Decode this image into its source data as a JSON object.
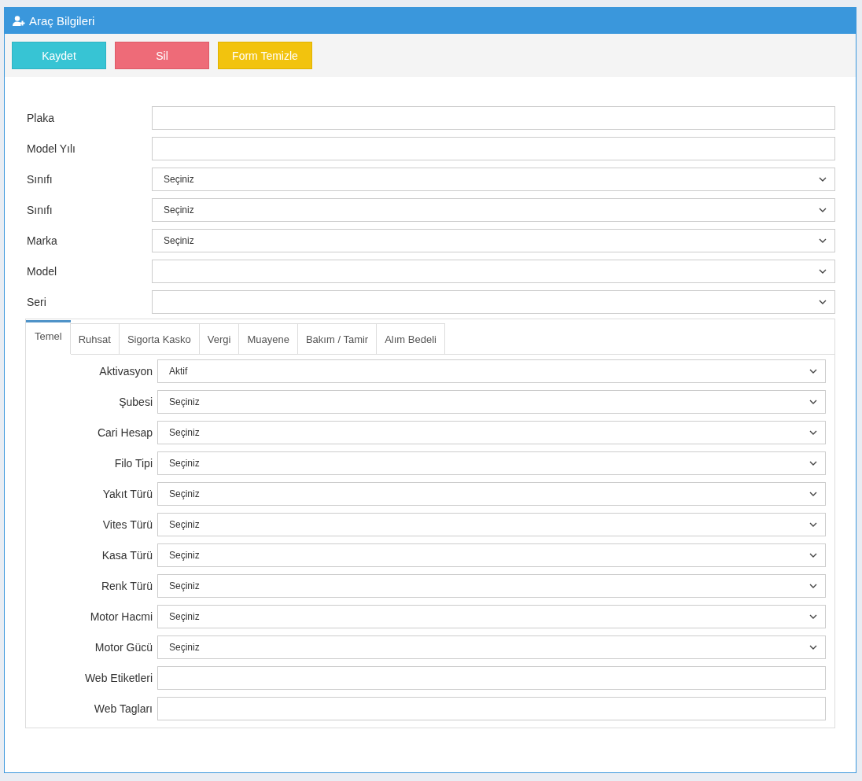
{
  "panel": {
    "title": "Araç Bilgileri"
  },
  "buttons": [
    {
      "label": "Kaydet",
      "kind": "info"
    },
    {
      "label": "Sil",
      "kind": "danger"
    },
    {
      "label": "Form Temizle",
      "kind": "warning"
    }
  ],
  "fields": [
    {
      "label": "Plaka",
      "kind": "text"
    },
    {
      "label": "Model Yılı",
      "kind": "text"
    },
    {
      "label": "Sınıfı",
      "kind": "select",
      "value": "Seçiniz"
    },
    {
      "label": "Sınıfı",
      "kind": "select",
      "value": "Seçiniz"
    },
    {
      "label": "Marka",
      "kind": "select",
      "value": "Seçiniz"
    },
    {
      "label": "Model",
      "kind": "select"
    },
    {
      "label": "Seri",
      "kind": "select"
    }
  ],
  "tabs": [
    {
      "label": "Temel",
      "selected": true
    },
    {
      "label": "Ruhsat",
      "selected": false
    },
    {
      "label": "Sigorta Kasko",
      "selected": false
    },
    {
      "label": "Vergi",
      "selected": false
    },
    {
      "label": "Muayene",
      "selected": false
    },
    {
      "label": "Bakım / Tamir",
      "selected": false
    },
    {
      "label": "Alım Bedeli",
      "selected": false
    }
  ],
  "tab_fields": [
    {
      "label": "Aktivasyon",
      "kind": "select",
      "value": "Aktif"
    },
    {
      "label": "Şubesi",
      "kind": "select",
      "value": "Seçiniz"
    },
    {
      "label": "Cari Hesap",
      "kind": "select",
      "value": "Seçiniz"
    },
    {
      "label": "Filo Tipi",
      "kind": "select",
      "value": "Seçiniz"
    },
    {
      "label": "Yakıt Türü",
      "kind": "select",
      "value": "Seçiniz"
    },
    {
      "label": "Vites Türü",
      "kind": "select",
      "value": "Seçiniz"
    },
    {
      "label": "Kasa Türü",
      "kind": "select",
      "value": "Seçiniz"
    },
    {
      "label": "Renk Türü",
      "kind": "select",
      "value": "Seçiniz"
    },
    {
      "label": "Motor Hacmi",
      "kind": "select",
      "value": "Seçiniz"
    },
    {
      "label": "Motor Gücü",
      "kind": "select",
      "value": "Seçiniz"
    },
    {
      "label": "Web Etiketleri",
      "kind": "text"
    },
    {
      "label": "Web Tagları",
      "kind": "text"
    }
  ]
}
